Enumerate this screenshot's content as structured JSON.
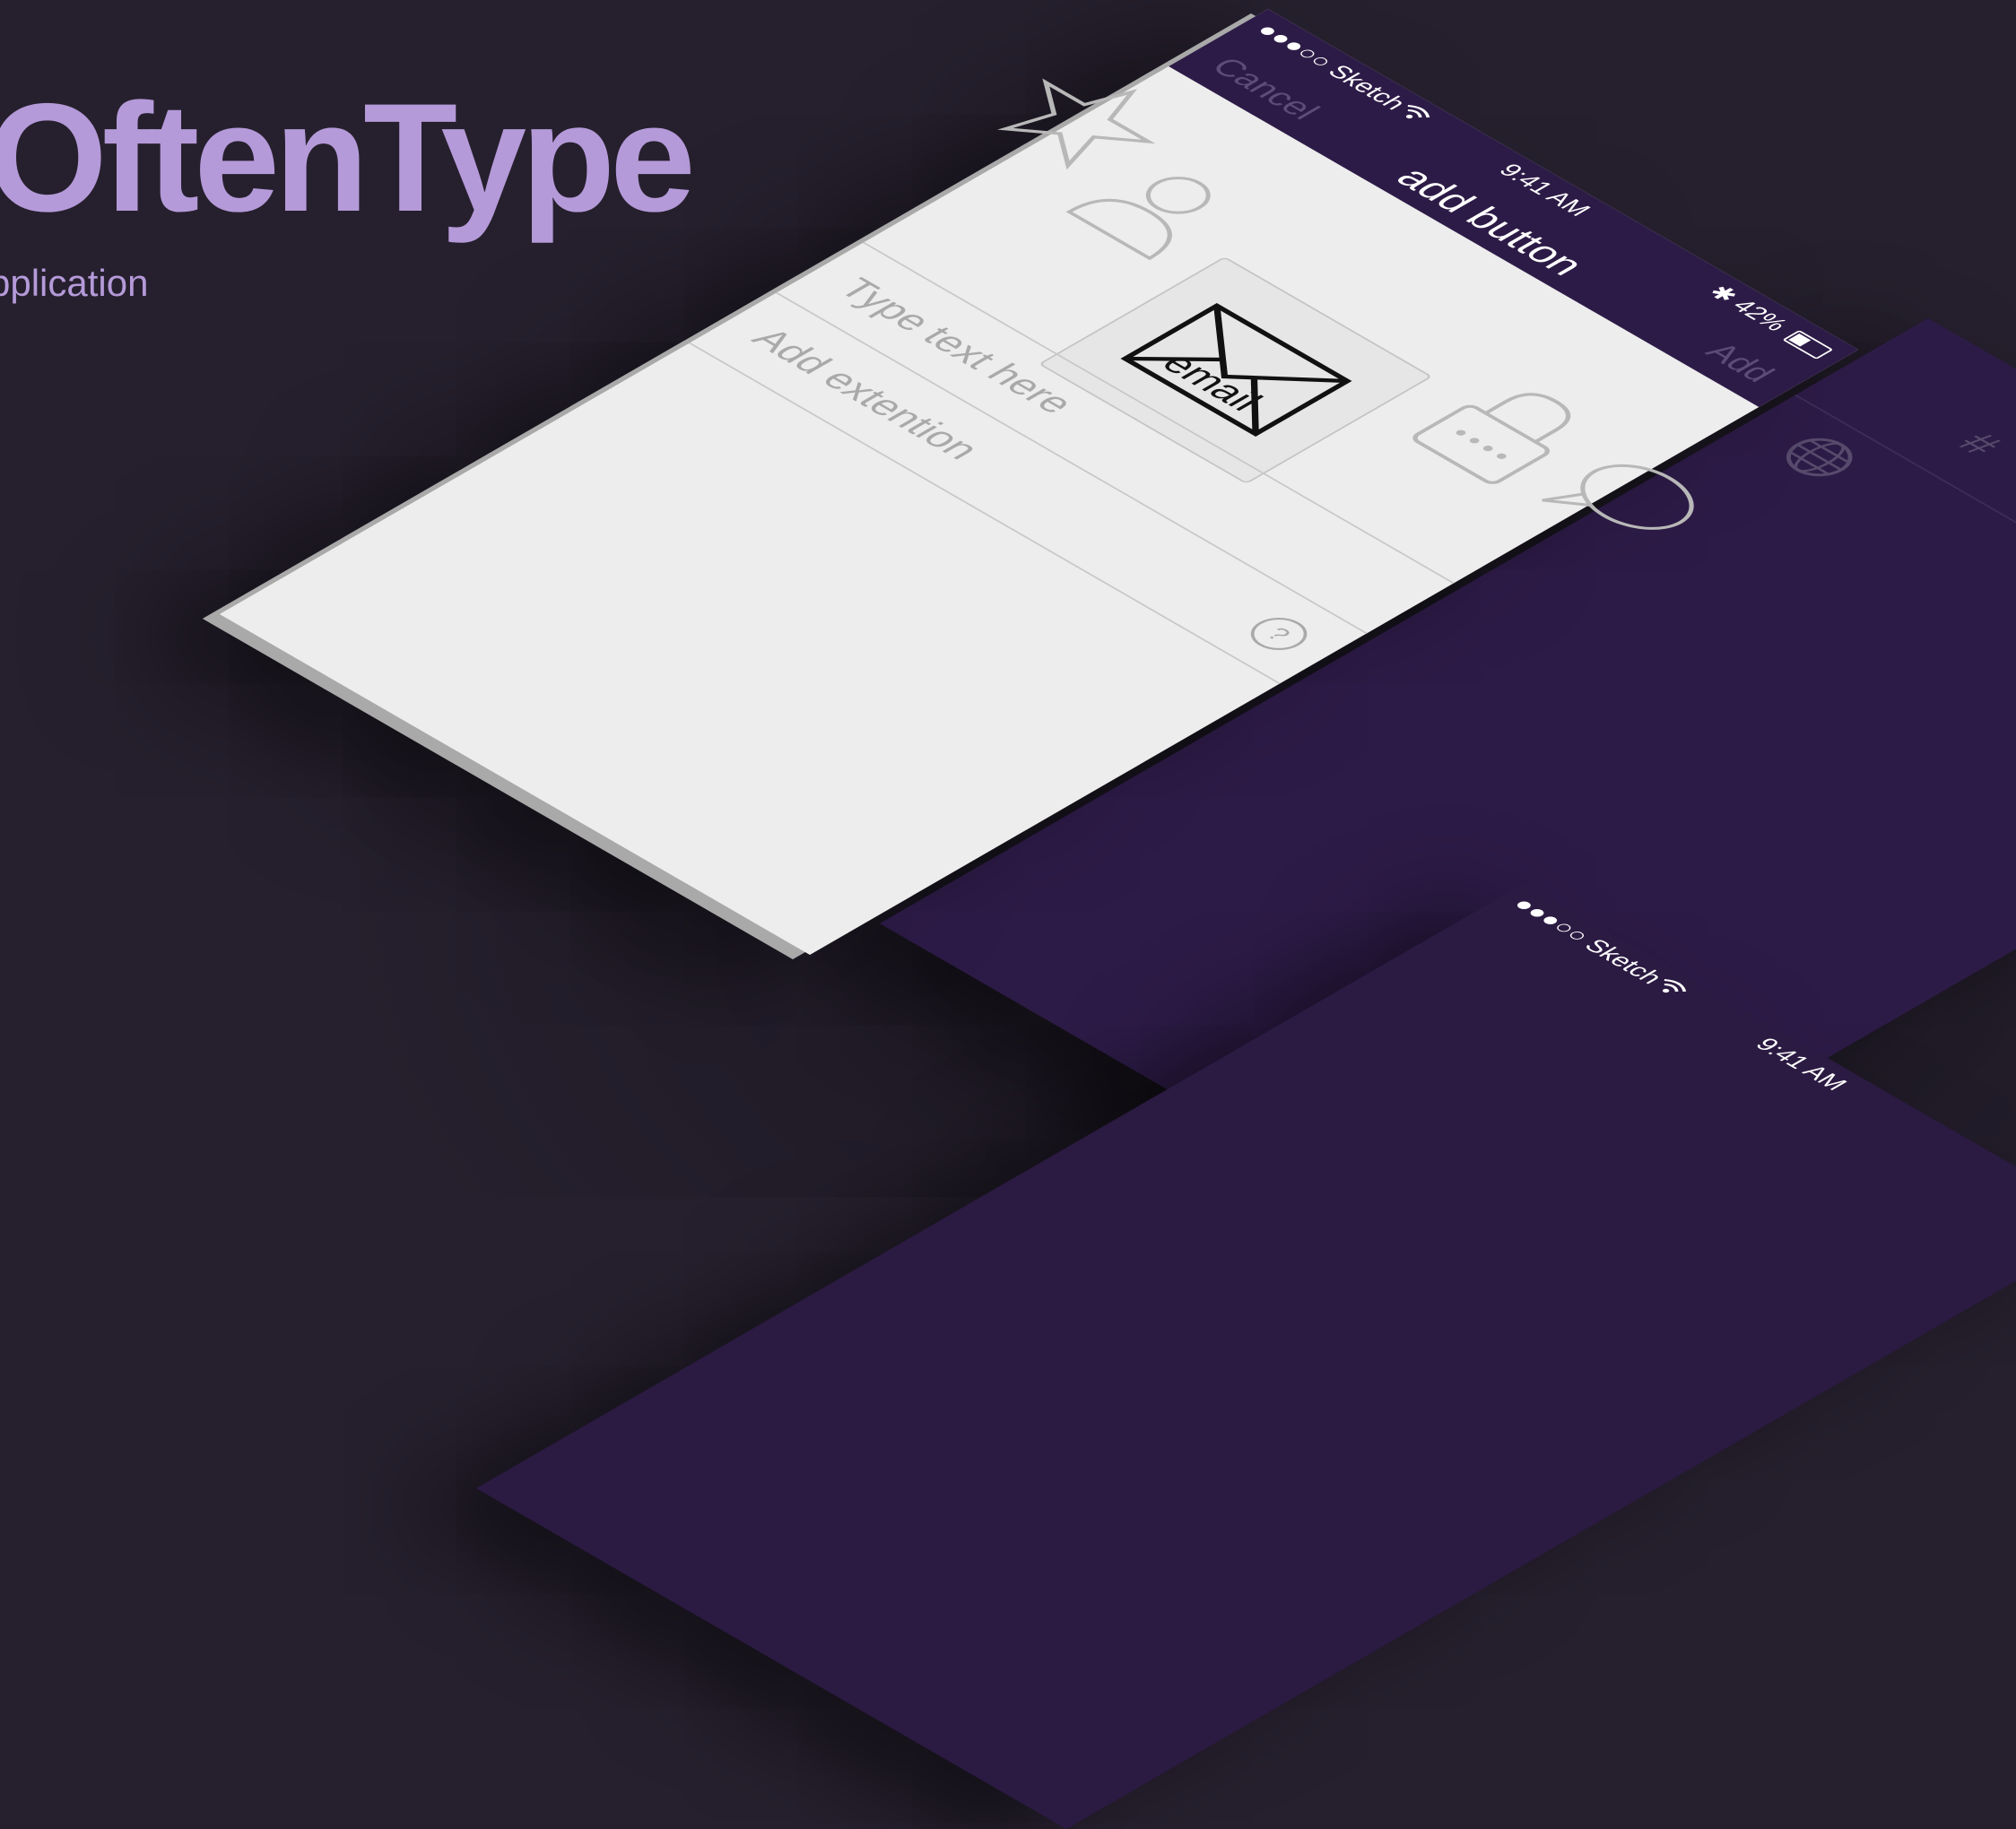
{
  "brand": {
    "title": "OftenType",
    "subtitle": "pplication"
  },
  "main_screen": {
    "status": {
      "carrier": "●●●○○ Sketch",
      "time": "9:41 AM",
      "battery_text": "42%",
      "battery_level": 0.42
    },
    "nav": {
      "cancel": "Cancel",
      "title": "add button",
      "add": "Add"
    },
    "icons": [
      "star-icon",
      "person-icon",
      "envelope-icon",
      "lock-icon",
      "speech-bubble-icon"
    ],
    "selected_icon_label": "email",
    "text_field_placeholder": "Type text here",
    "extension_field_placeholder": "Add extention"
  },
  "lower_screen": {
    "status": {
      "carrier": "●●●○○ Sketch",
      "time": "9:41 AM"
    }
  },
  "right_screen": {
    "symbol": "#"
  },
  "colors": {
    "background": "#26202e",
    "brand": "#b59ad9",
    "nav_bar": "#2d1b47",
    "sheet": "#ededed"
  }
}
